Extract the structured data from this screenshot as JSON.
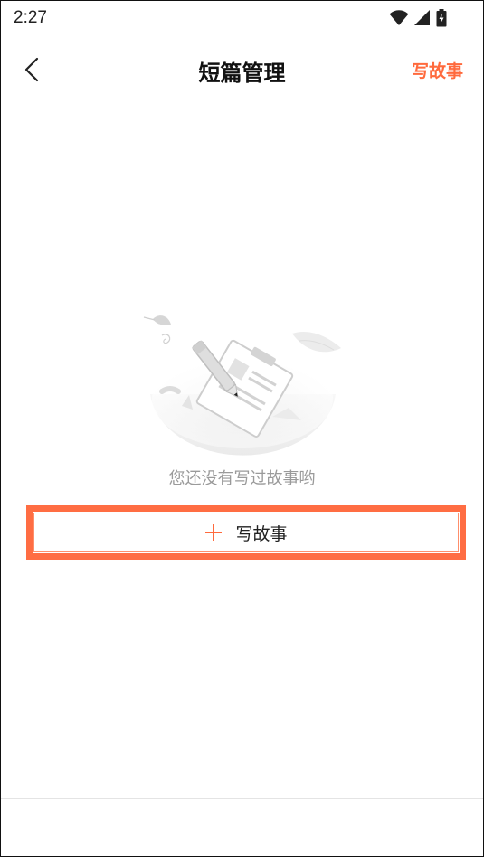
{
  "status_bar": {
    "time": "2:27",
    "icons": [
      "wifi-icon",
      "cellular-signal-icon",
      "battery-charging-icon"
    ]
  },
  "header": {
    "back_icon": "back-chevron-icon",
    "title": "短篇管理",
    "action_label": "写故事"
  },
  "empty_state": {
    "illustration": "empty-manuscript-illustration",
    "message": "您还没有写过故事哟"
  },
  "write_button": {
    "icon": "plus-icon",
    "label": "写故事"
  },
  "colors": {
    "accent": "#ff6a3d",
    "highlight_border": "#ff6d43",
    "empty_text": "#9a9a9a",
    "title": "#111111"
  }
}
